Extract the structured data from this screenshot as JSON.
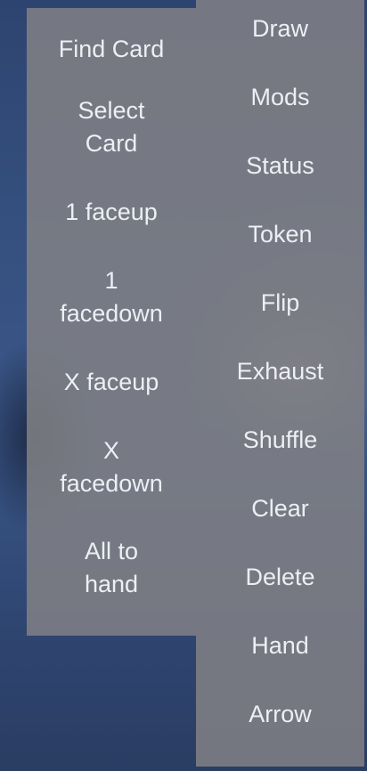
{
  "left_menu": {
    "find_card": "Find Card",
    "select_card": [
      "Select",
      "Card"
    ],
    "one_faceup": "1 faceup",
    "one_facedown": [
      "1",
      "facedown"
    ],
    "x_faceup": "X faceup",
    "x_facedown": [
      "X",
      "facedown"
    ],
    "all_to_hand": [
      "All to",
      "hand"
    ]
  },
  "right_menu": {
    "draw": "Draw",
    "mods": "Mods",
    "status": "Status",
    "token": "Token",
    "flip": "Flip",
    "exhaust": "Exhaust",
    "shuffle": "Shuffle",
    "clear": "Clear",
    "delete": "Delete",
    "hand": "Hand",
    "arrow": "Arrow"
  },
  "colors": {
    "panel": "#808084",
    "text": "#eceff3",
    "background": "#35507f"
  }
}
